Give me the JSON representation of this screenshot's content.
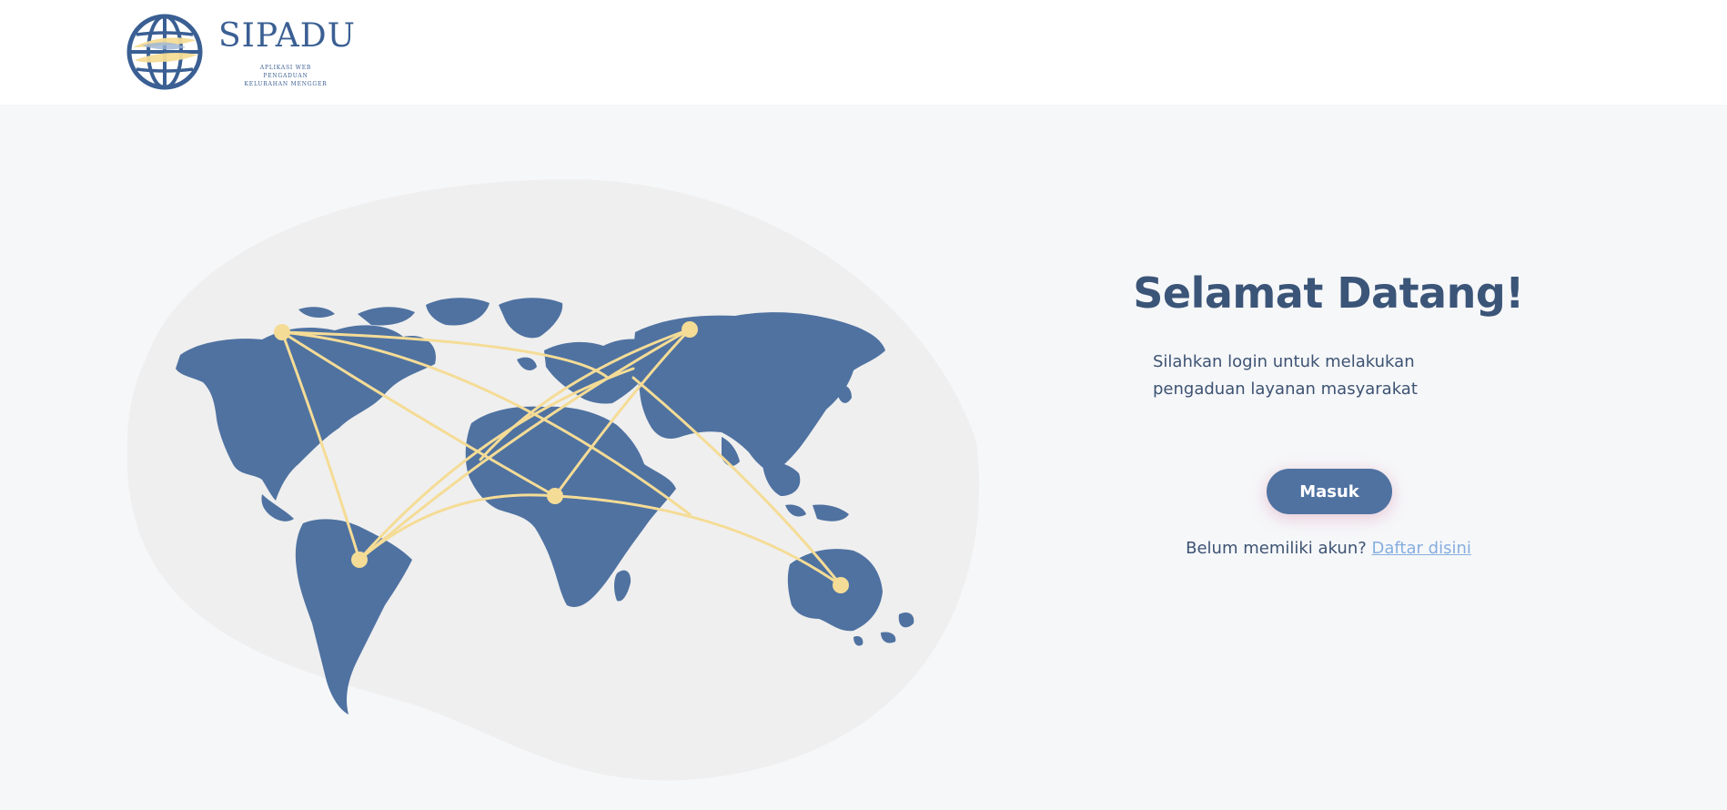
{
  "brand": {
    "name": "SIPADU",
    "tagline": [
      "APLIKASI WEB",
      "PENGADUAN",
      "KELURAHAN MENGGER"
    ],
    "color": "#3a5f93",
    "accent": "#f5dc96"
  },
  "hero": {
    "title": "Selamat Datang!",
    "description": "Silahkan login untuk melakukan pengaduan layanan masyarakat",
    "login_button": "Masuk",
    "register_prompt": "Belum memiliki akun?",
    "register_link": "Daftar disini"
  },
  "illustration": {
    "name": "world-map-network",
    "land_color": "#4f72a1",
    "line_color": "#f5dc96",
    "blob_color": "#efefef"
  },
  "colors": {
    "background": "#f6f7f9",
    "navbar": "#ffffff",
    "button": "#4f72a1",
    "link": "#86aee0"
  }
}
